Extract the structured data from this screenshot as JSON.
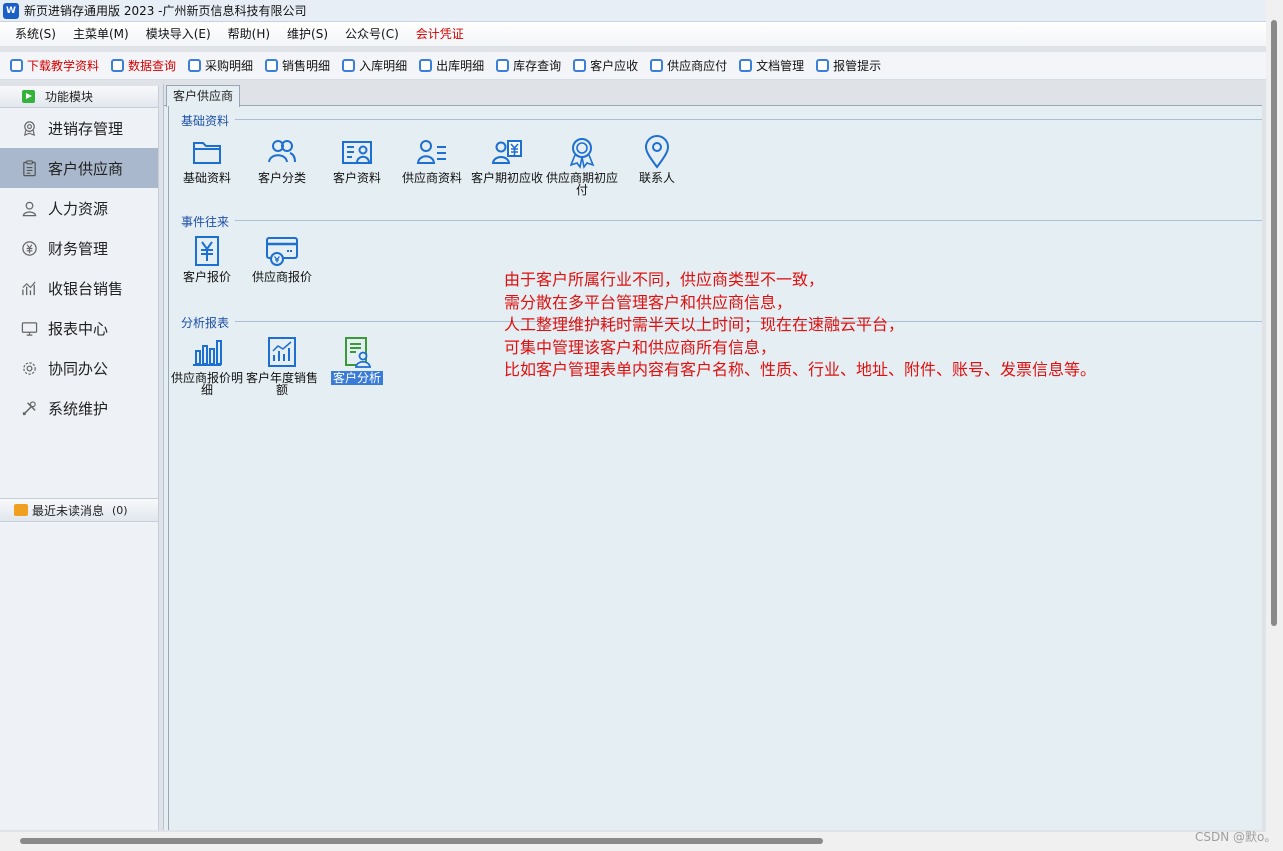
{
  "window": {
    "title": "新页进销存通用版 2023 -广州新页信息科技有限公司",
    "app_icon": "W"
  },
  "menubar": [
    {
      "label": "系统(S)"
    },
    {
      "label": "主菜单(M)"
    },
    {
      "label": "模块导入(E)"
    },
    {
      "label": "帮助(H)"
    },
    {
      "label": "维护(S)"
    },
    {
      "label": "公众号(C)"
    },
    {
      "label": "会计凭证",
      "color": "#d40000"
    }
  ],
  "toolbar": [
    {
      "label": "下载教学资料",
      "color": "#d40000"
    },
    {
      "label": "数据查询",
      "color": "#d40000"
    },
    {
      "label": "采购明细"
    },
    {
      "label": "销售明细"
    },
    {
      "label": "入库明细"
    },
    {
      "label": "出库明细"
    },
    {
      "label": "库存查询"
    },
    {
      "label": "客户应收"
    },
    {
      "label": "供应商应付"
    },
    {
      "label": "文档管理"
    },
    {
      "label": "报管提示"
    }
  ],
  "sidebar": {
    "header": "功能模块",
    "items": [
      {
        "label": "进销存管理",
        "icon": "medal-icon"
      },
      {
        "label": "客户供应商",
        "icon": "clipboard-icon",
        "active": true
      },
      {
        "label": "人力资源",
        "icon": "person-icon"
      },
      {
        "label": "财务管理",
        "icon": "coin-icon"
      },
      {
        "label": "收银台销售",
        "icon": "trend-icon"
      },
      {
        "label": "报表中心",
        "icon": "monitor-icon"
      },
      {
        "label": "协同办公",
        "icon": "gear-icon"
      },
      {
        "label": "系统维护",
        "icon": "tools-icon"
      }
    ],
    "messages": {
      "label": "最近未读消息",
      "count": "(0)"
    }
  },
  "main": {
    "tab": "客户供应商",
    "sections": [
      {
        "title": "基础资料",
        "tiles": [
          {
            "label": "基础资料",
            "icon": "folder-icon"
          },
          {
            "label": "客户分类",
            "icon": "users-icon"
          },
          {
            "label": "客户资料",
            "icon": "contact-card-icon"
          },
          {
            "label": "供应商资料",
            "icon": "supplier-list-icon"
          },
          {
            "label": "客户期初应收",
            "icon": "receivable-icon"
          },
          {
            "label": "供应商期初应付",
            "icon": "payable-badge-icon"
          },
          {
            "label": "联系人",
            "icon": "location-pin-icon"
          }
        ]
      },
      {
        "title": "事件往来",
        "tiles": [
          {
            "label": "客户报价",
            "icon": "yen-doc-icon"
          },
          {
            "label": "供应商报价",
            "icon": "card-icon"
          }
        ]
      },
      {
        "title": "分析报表",
        "tiles": [
          {
            "label": "供应商报价明细",
            "icon": "bar-chart-icon"
          },
          {
            "label": "客户年度销售额",
            "icon": "line-chart-icon"
          },
          {
            "label": "客户分析",
            "icon": "report-user-icon",
            "selected": true
          }
        ]
      }
    ],
    "note_lines": [
      "由于客户所属行业不同，供应商类型不一致，",
      "需分散在多平台管理客户和供应商信息，",
      "人工整理维护耗时需半天以上时间；现在在速融云平台，",
      "可集中管理该客户和供应商所有信息，",
      "比如客户管理表单内容有客户名称、性质、行业、地址、附件、账号、发票信息等。"
    ]
  },
  "watermark": "CSDN @默o。",
  "colors": {
    "accent_blue": "#1d6fd1",
    "alert_red": "#d40000",
    "note_red": "#e01010",
    "active_nav": "#a9b8cc"
  }
}
